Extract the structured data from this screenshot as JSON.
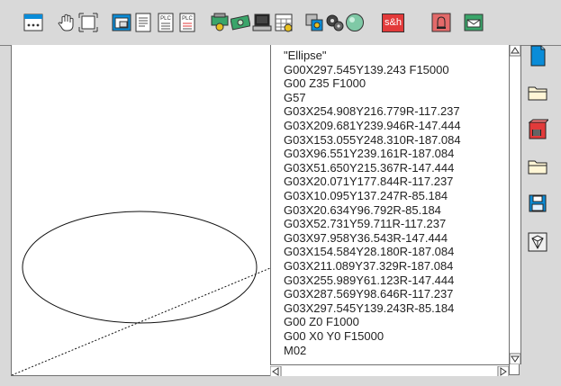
{
  "toolbar": {
    "buttons": [
      {
        "name": "io-panel-button",
        "icon": "io-panel-icon"
      },
      {
        "name": "pan-hand-button",
        "icon": "hand-icon"
      },
      {
        "name": "fit-window-button",
        "icon": "fit-view-icon"
      },
      {
        "name": "screen-layout-button",
        "icon": "layout-icon"
      },
      {
        "name": "document-button",
        "icon": "document-icon"
      },
      {
        "name": "plc-button",
        "icon": "plc-icon"
      },
      {
        "name": "plc-edit-button",
        "icon": "plc-edit-icon"
      },
      {
        "name": "machine-button",
        "icon": "machine-icon"
      },
      {
        "name": "money-button",
        "icon": "money-icon"
      },
      {
        "name": "computer-button",
        "icon": "computer-icon"
      },
      {
        "name": "calendar-button",
        "icon": "calendar-icon"
      },
      {
        "name": "tool-holder-button",
        "icon": "tool-holder-icon"
      },
      {
        "name": "gears-button",
        "icon": "gears-icon"
      },
      {
        "name": "sphere-button",
        "icon": "sphere-icon"
      },
      {
        "name": "sh-button",
        "icon": "sh-icon"
      },
      {
        "name": "alarm-bell-button",
        "icon": "bell-icon"
      },
      {
        "name": "message-button",
        "icon": "envelope-icon"
      }
    ],
    "sh_label": "s&h",
    "plc_label": "PLC"
  },
  "code": {
    "lines": [
      "\"Ellipse\"",
      "G00X297.545Y139.243 F15000",
      "G00 Z35 F1000",
      "G57",
      "G03X254.908Y216.779R-117.237",
      "G03X209.681Y239.946R-147.444",
      "G03X153.055Y248.310R-187.084",
      "G03X96.551Y239.161R-187.084",
      "G03X51.650Y215.367R-147.444",
      "G03X20.071Y177.844R-117.237",
      "G03X10.095Y137.247R-85.184",
      "G03X20.634Y96.792R-85.184",
      "G03X52.731Y59.711R-117.237",
      "G03X97.958Y36.543R-147.444",
      "G03X154.584Y28.180R-187.084",
      "G03X211.089Y37.329R-187.084",
      "G03X255.989Y61.123R-147.444",
      "G03X287.569Y98.646R-117.237",
      "G03X297.545Y139.243R-85.184",
      "G00 Z0 F1000",
      "G00 X0 Y0 F15000",
      "M02"
    ]
  },
  "sidebar": {
    "buttons": [
      {
        "name": "new-file-button",
        "icon": "new-file-icon"
      },
      {
        "name": "open-folder-button",
        "icon": "folder-icon"
      },
      {
        "name": "machine-library-button",
        "icon": "machine-library-icon"
      },
      {
        "name": "open-folder-2-button",
        "icon": "folder-icon"
      },
      {
        "name": "save-button",
        "icon": "floppy-disk-icon"
      },
      {
        "name": "erase-button",
        "icon": "eraser-icon"
      }
    ]
  },
  "colors": {
    "accent_blue": "#0a8cd8",
    "accent_green": "#3aa56a",
    "accent_red": "#e23a3a",
    "panel_bg": "#d9d9d9"
  }
}
